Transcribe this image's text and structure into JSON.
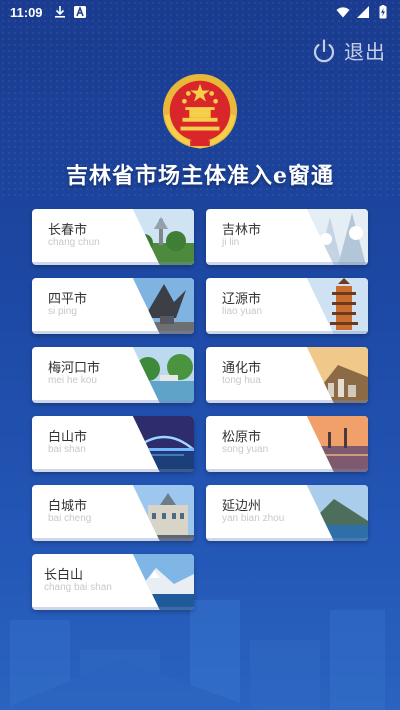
{
  "status_bar": {
    "time": "11:09",
    "left_icons": [
      "download-icon",
      "a-badge-icon"
    ],
    "right_icons": [
      "wifi-icon",
      "signal-icon",
      "battery-charging-icon"
    ]
  },
  "header": {
    "logout_label": "退出",
    "logout_icon": "power-icon",
    "emblem": "national-emblem-icon",
    "title": "吉林省市场主体准入e窗通"
  },
  "colors": {
    "background_top": "#1a3b8f",
    "background_bottom": "#2a63c0",
    "card_bg": "#ffffff",
    "city_name": "#333333",
    "pinyin": "#c8c8c8"
  },
  "cities": [
    {
      "name": "长春市",
      "pinyin": "chang chun",
      "photo": "park-tower-photo"
    },
    {
      "name": "吉林市",
      "pinyin": "ji lin",
      "photo": "rime-trees-photo"
    },
    {
      "name": "四平市",
      "pinyin": "si ping",
      "photo": "eagle-monument-photo"
    },
    {
      "name": "辽源市",
      "pinyin": "liao yuan",
      "photo": "pagoda-photo"
    },
    {
      "name": "梅河口市",
      "pinyin": "mei he kou",
      "photo": "park-lake-photo"
    },
    {
      "name": "通化市",
      "pinyin": "tong hua",
      "photo": "hillside-city-photo"
    },
    {
      "name": "白山市",
      "pinyin": "bai shan",
      "photo": "night-bridge-photo"
    },
    {
      "name": "松原市",
      "pinyin": "song yuan",
      "photo": "sunset-river-photo"
    },
    {
      "name": "白城市",
      "pinyin": "bai cheng",
      "photo": "building-photo"
    },
    {
      "name": "延边州",
      "pinyin": "yan bian zhou",
      "photo": "mountain-lake-photo"
    },
    {
      "name": "长白山",
      "pinyin": "chang bai shan",
      "photo": "snow-mountain-photo"
    }
  ]
}
